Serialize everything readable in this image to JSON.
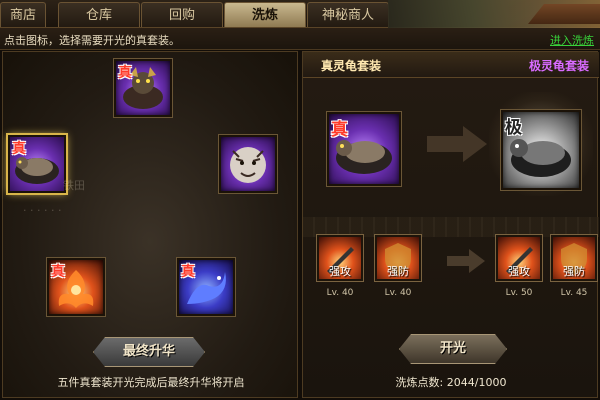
{
  "tabs": [
    "商店",
    "仓库",
    "回购",
    "洗炼",
    "神秘商人"
  ],
  "instruction": "点击图标，选择需要开光的真套装。",
  "enter_link": "进入洗炼",
  "left": {
    "items": [
      {
        "badge": "真",
        "style": "purple"
      },
      {
        "badge": "真",
        "style": "purple"
      },
      {
        "badge": "",
        "style": "purple"
      },
      {
        "badge": "真",
        "style": "fire"
      },
      {
        "badge": "真",
        "style": "blue"
      }
    ],
    "button": "最终升华",
    "note": "五件真套装开光完成后最终升华将开启"
  },
  "right": {
    "from_title": "真灵龟套装",
    "to_title": "极灵龟套装",
    "from_item": {
      "badge": "真"
    },
    "to_item": {
      "badge": "极"
    },
    "skills_from": [
      {
        "label": "强攻",
        "level": "Lv. 40"
      },
      {
        "label": "强防",
        "level": "Lv. 40"
      }
    ],
    "skills_to": [
      {
        "label": "强攻",
        "level": "Lv. 50"
      },
      {
        "label": "强防",
        "level": "Lv. 45"
      }
    ],
    "button": "开光",
    "points_label": "洗炼点数:",
    "points_value": "2044/1000"
  },
  "colors": {
    "accent_green": "#39d33a",
    "set_purple": "#d86bff",
    "badge_red": "#ff3b2b"
  }
}
